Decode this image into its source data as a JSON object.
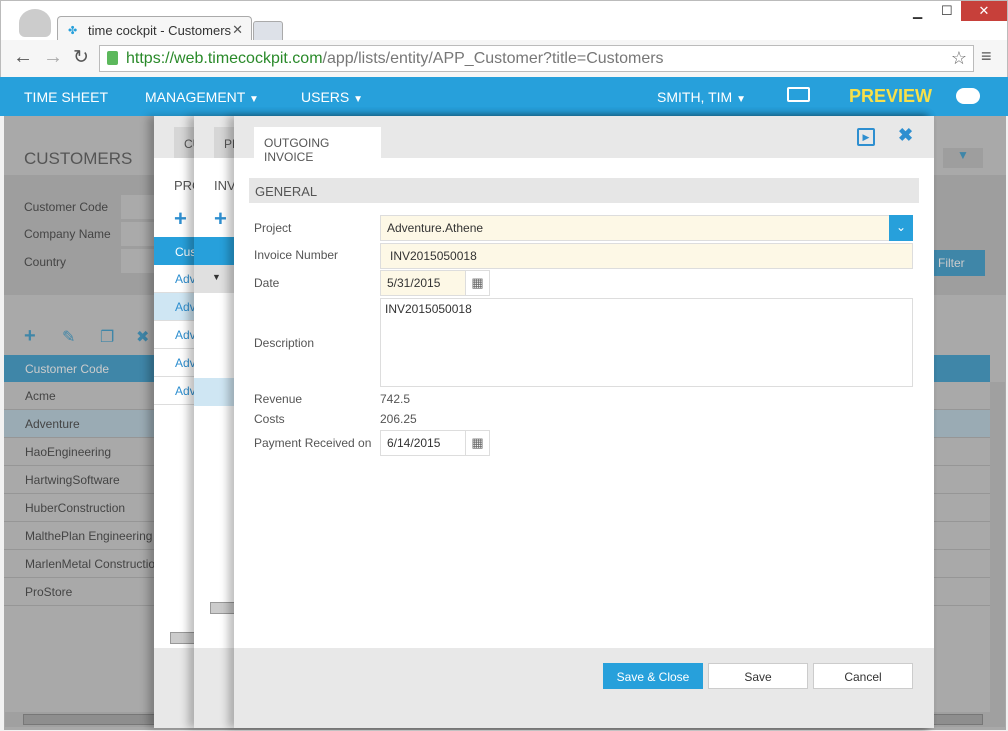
{
  "browser": {
    "tab_title": "time cockpit - Customers",
    "url_host": "https://web.timecockpit.com",
    "url_path": "/app/lists/entity/APP_Customer?title=Customers"
  },
  "nav": {
    "items": [
      "TIME SHEET",
      "MANAGEMENT",
      "USERS"
    ],
    "user": "SMITH, TIM",
    "preview": "PREVIEW",
    "accent": "#27a0db",
    "preview_color": "#f7e04a"
  },
  "background": {
    "title": "CUSTOMERS",
    "filters": [
      "Customer Code",
      "Company Name",
      "Country"
    ],
    "filter_button": "Filter",
    "column_header": "Customer Code",
    "rows": [
      "Acme",
      "Adventure",
      "HaoEngineering",
      "HartwingSoftware",
      "HuberConstruction",
      "MalthePlan Engineering",
      "MarlenMetal Construction",
      "ProStore"
    ],
    "selected": "Adventure"
  },
  "panel1": {
    "tab": "CU",
    "title": "PRO",
    "header": "Cus",
    "rows": [
      "Adv",
      "Adv",
      "Adv",
      "Adv",
      "Adv"
    ]
  },
  "panel2": {
    "tab": "PR",
    "title": "INV"
  },
  "dialog": {
    "tab": "OUTGOING INVOICE",
    "section": "GENERAL",
    "labels": {
      "project": "Project",
      "invoice_number": "Invoice Number",
      "date": "Date",
      "description": "Description",
      "revenue": "Revenue",
      "costs": "Costs",
      "payment": "Payment Received on"
    },
    "values": {
      "project": "Adventure.Athene",
      "invoice_number": "INV2015050018",
      "date": "5/31/2015",
      "description": "INV2015050018",
      "revenue": "742.5",
      "costs": "206.25",
      "payment": "6/14/2015"
    },
    "buttons": {
      "save_close": "Save & Close",
      "save": "Save",
      "cancel": "Cancel"
    }
  }
}
